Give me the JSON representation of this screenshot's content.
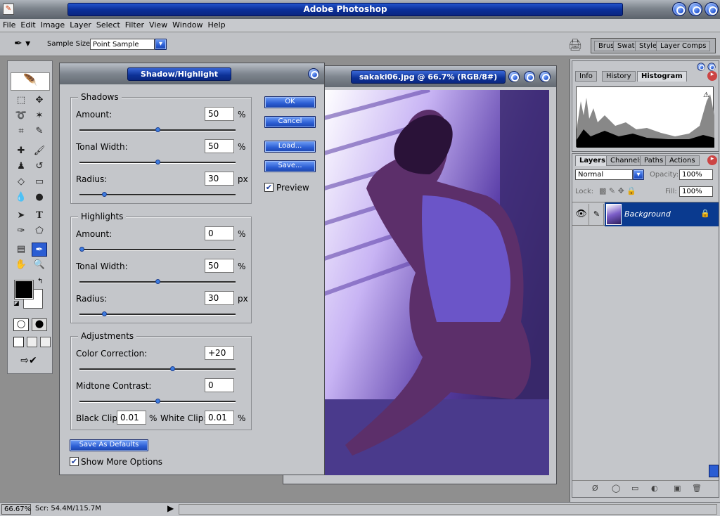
{
  "app": {
    "title": "Adobe Photoshop"
  },
  "menu": [
    "File",
    "Edit",
    "Image",
    "Layer",
    "Select",
    "Filter",
    "View",
    "Window",
    "Help"
  ],
  "options": {
    "sample_size_label": "Sample Size:",
    "sample_size_value": "Point Sample"
  },
  "palette_well": {
    "tabs": [
      "Brus",
      "Swat",
      "Style",
      "Layer Comps"
    ]
  },
  "dialog": {
    "title": "Shadow/Highlight",
    "shadows": {
      "title": "Shadows",
      "amount": {
        "label": "Amount:",
        "value": "50",
        "unit": "%",
        "level": 0.5
      },
      "tonal": {
        "label": "Tonal Width:",
        "value": "50",
        "unit": "%",
        "level": 0.5
      },
      "radius": {
        "label": "Radius:",
        "value": "30",
        "unit": "px",
        "level": 0.15
      }
    },
    "highlights": {
      "title": "Highlights",
      "amount": {
        "label": "Amount:",
        "value": "0",
        "unit": "%",
        "level": 0.0
      },
      "tonal": {
        "label": "Tonal Width:",
        "value": "50",
        "unit": "%",
        "level": 0.5
      },
      "radius": {
        "label": "Radius:",
        "value": "30",
        "unit": "px",
        "level": 0.15
      }
    },
    "adjustments": {
      "title": "Adjustments",
      "color": {
        "label": "Color Correction:",
        "value": "+20",
        "level": 0.6
      },
      "midtone": {
        "label": "Midtone Contrast:",
        "value": "0",
        "level": 0.5
      },
      "black_clip_label": "Black Clip:",
      "black_clip": "0.01",
      "pct": "%",
      "white_clip_label": "White Clip:",
      "white_clip": "0.01"
    },
    "buttons": {
      "ok": "OK",
      "cancel": "Cancel",
      "load": "Load...",
      "save": "Save...",
      "defaults": "Save As Defaults"
    },
    "preview_label": "Preview",
    "preview_checked": true,
    "more_label": "Show More Options",
    "more_checked": true
  },
  "image_window": {
    "title": "sakaki06.jpg @ 66.7% (RGB/8#)"
  },
  "navigator": {
    "tabs": [
      "Info",
      "History",
      "Histogram"
    ],
    "active": "Histogram"
  },
  "layers": {
    "tabs": [
      "Layers",
      "Channels",
      "Paths",
      "Actions"
    ],
    "active": "Layers",
    "blend_mode": "Normal",
    "opacity_label": "Opacity:",
    "opacity": "100%",
    "lock_label": "Lock:",
    "fill_label": "Fill:",
    "fill": "100%",
    "items": [
      {
        "name": "Background"
      }
    ]
  },
  "status": {
    "zoom": "66.67%",
    "doc": "Scr: 54.4M/115.7M"
  }
}
